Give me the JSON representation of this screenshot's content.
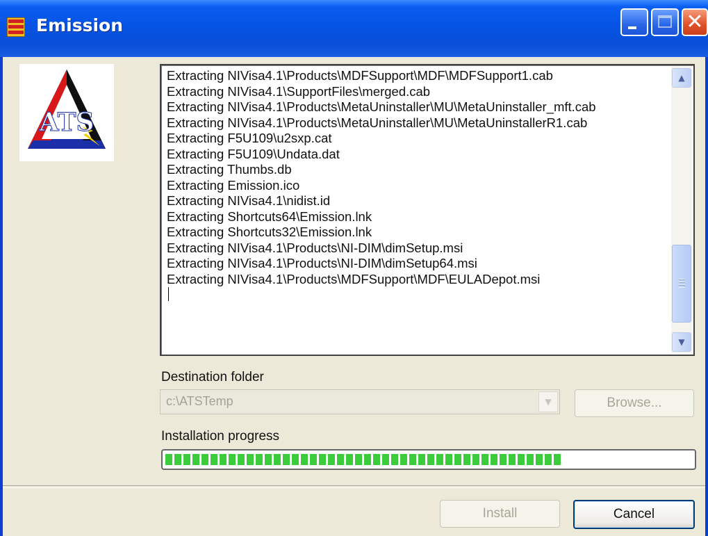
{
  "window": {
    "title": "Emission",
    "app_icon": "installer-icon",
    "controls": [
      "minimize-icon",
      "maximize-icon",
      "close-icon"
    ]
  },
  "logo": {
    "text": "ATS",
    "icon": "ats-logo"
  },
  "log": {
    "lines": [
      "Extracting NIVisa4.1\\Products\\MDFSupport\\MDF\\MDFSupport1.cab",
      "Extracting NIVisa4.1\\SupportFiles\\merged.cab",
      "Extracting NIVisa4.1\\Products\\MetaUninstaller\\MU\\MetaUninstaller_mft.cab",
      "Extracting NIVisa4.1\\Products\\MetaUninstaller\\MU\\MetaUninstallerR1.cab",
      "Extracting F5U109\\u2sxp.cat",
      "Extracting F5U109\\Undata.dat",
      "Extracting Thumbs.db",
      "Extracting Emission.ico",
      "Extracting NIVisa4.1\\nidist.id",
      "Extracting Shortcuts64\\Emission.lnk",
      "Extracting Shortcuts32\\Emission.lnk",
      "Extracting NIVisa4.1\\Products\\NI-DIM\\dimSetup.msi",
      "Extracting NIVisa4.1\\Products\\NI-DIM\\dimSetup64.msi",
      "Extracting NIVisa4.1\\Products\\MDFSupport\\MDF\\EULADepot.msi"
    ],
    "scroll_up_icon": "scroll-up-arrow-icon",
    "scroll_down_icon": "scroll-down-arrow-icon"
  },
  "destination": {
    "label": "Destination folder",
    "value": "c:\\ATSTemp",
    "browse_label": "Browse...",
    "enabled": false
  },
  "progress": {
    "label": "Installation progress",
    "fraction": 0.75,
    "color": "#3ccb3a"
  },
  "buttons": {
    "install_label": "Install",
    "install_enabled": false,
    "cancel_label": "Cancel"
  },
  "colors": {
    "titlebar": "#0a5ef0",
    "client_bg": "#ece9d8",
    "close_button": "#e0512a"
  }
}
